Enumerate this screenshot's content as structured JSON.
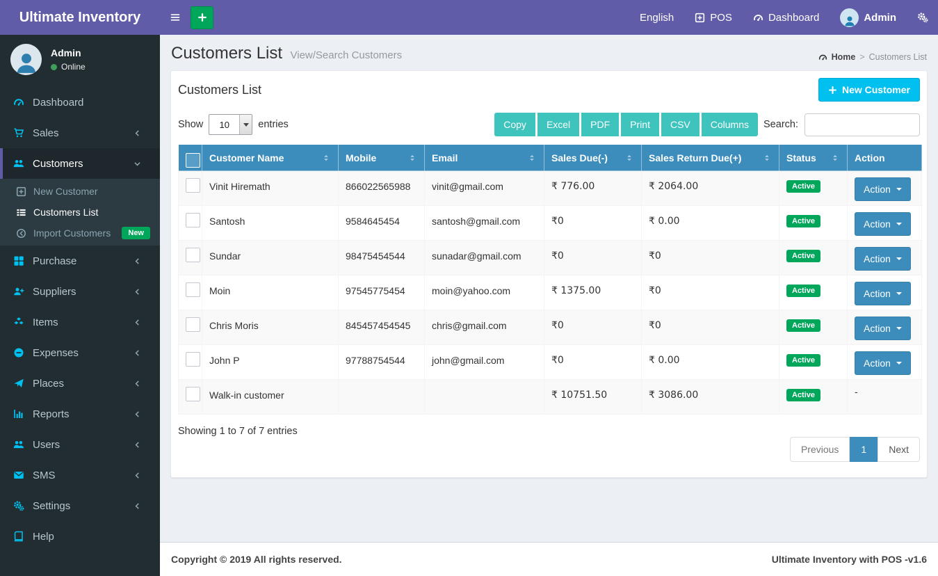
{
  "colors": {
    "navbar_purple": "#605ca8",
    "sidebar_dark": "#222d32",
    "sidebar_icon_blue": "#00c0ef",
    "green": "#00a65a",
    "table_header_blue": "#3c8dbc",
    "info_cyan": "#00c0ef",
    "export_teal": "#3ec3bd",
    "content_bg": "#ecf0f5"
  },
  "navbar": {
    "brand": "Ultimate Inventory",
    "menu_toggle_icon": "hamburger-icon",
    "quick_add_icon": "plus-icon",
    "language": "English",
    "pos": {
      "label": "POS",
      "icon": "plus-square-icon"
    },
    "dashboard": {
      "label": "Dashboard",
      "icon": "gauge-icon"
    },
    "user": {
      "label": "Admin",
      "icon": "person-icon"
    },
    "settings_icon": "cogs-icon"
  },
  "sidebar": {
    "user": {
      "name": "Admin",
      "status": "Online"
    },
    "items": [
      {
        "label": "Dashboard",
        "icon": "gauge-icon"
      },
      {
        "label": "Sales",
        "icon": "cart-icon"
      },
      {
        "label": "Customers",
        "icon": "users-icon"
      },
      {
        "label": "Purchase",
        "icon": "grid-icon"
      },
      {
        "label": "Suppliers",
        "icon": "user-plus-icon"
      },
      {
        "label": "Items",
        "icon": "cubes-icon"
      },
      {
        "label": "Expenses",
        "icon": "minus-circle-icon"
      },
      {
        "label": "Places",
        "icon": "paper-plane-icon"
      },
      {
        "label": "Reports",
        "icon": "bar-chart-icon"
      },
      {
        "label": "Users",
        "icon": "users-icon"
      },
      {
        "label": "SMS",
        "icon": "envelope-icon"
      },
      {
        "label": "Settings",
        "icon": "cogs-icon"
      },
      {
        "label": "Help",
        "icon": "book-icon"
      }
    ],
    "customers_submenu": [
      {
        "label": "New Customer",
        "icon": "plus-square-icon"
      },
      {
        "label": "Customers List",
        "icon": "list-icon"
      },
      {
        "label": "Import Customers",
        "icon": "arrow-circle-left-icon",
        "badge": "New"
      }
    ]
  },
  "content_header": {
    "title": "Customers List",
    "subtitle": "View/Search Customers",
    "breadcrumb": {
      "home": "Home",
      "separator": ">",
      "current": "Customers List"
    }
  },
  "panel": {
    "title": "Customers List",
    "new_customer_button": "New Customer",
    "show_label": "Show",
    "entries_per_page": "10",
    "entries_label": "entries",
    "export_buttons": [
      "Copy",
      "Excel",
      "PDF",
      "Print",
      "CSV",
      "Columns"
    ],
    "search_label": "Search:",
    "search_value": ""
  },
  "table": {
    "columns": [
      "Customer Name",
      "Mobile",
      "Email",
      "Sales Due(-)",
      "Sales Return Due(+)",
      "Status",
      "Action"
    ],
    "rows": [
      {
        "name": "Vinit Hiremath",
        "mobile": "866022565988",
        "email": "vinit@gmail.com",
        "sales_due": "₹ 776.00",
        "sales_return_due": "₹ 2064.00",
        "status": "Active",
        "action": "Action"
      },
      {
        "name": "Santosh",
        "mobile": "9584645454",
        "email": "santosh@gmail.com",
        "sales_due": "₹0",
        "sales_return_due": "₹ 0.00",
        "status": "Active",
        "action": "Action"
      },
      {
        "name": "Sundar",
        "mobile": "98475454544",
        "email": "sunadar@gmail.com",
        "sales_due": "₹0",
        "sales_return_due": "₹0",
        "status": "Active",
        "action": "Action"
      },
      {
        "name": "Moin",
        "mobile": "97545775454",
        "email": "moin@yahoo.com",
        "sales_due": "₹ 1375.00",
        "sales_return_due": "₹0",
        "status": "Active",
        "action": "Action"
      },
      {
        "name": "Chris Moris",
        "mobile": "845457454545",
        "email": "chris@gmail.com",
        "sales_due": "₹0",
        "sales_return_due": "₹0",
        "status": "Active",
        "action": "Action"
      },
      {
        "name": "John P",
        "mobile": "97788754544",
        "email": "john@gmail.com",
        "sales_due": "₹0",
        "sales_return_due": "₹ 0.00",
        "status": "Active",
        "action": "Action"
      },
      {
        "name": "Walk-in customer",
        "mobile": "",
        "email": "",
        "sales_due": "₹ 10751.50",
        "sales_return_due": "₹ 3086.00",
        "status": "Active",
        "action": "-"
      }
    ],
    "info": "Showing 1 to 7 of 7 entries",
    "pagination": {
      "previous": "Previous",
      "current": "1",
      "next": "Next"
    }
  },
  "footer": {
    "copyright": "Copyright © 2019 All rights reserved.",
    "version": "Ultimate Inventory with POS -v1.6"
  }
}
